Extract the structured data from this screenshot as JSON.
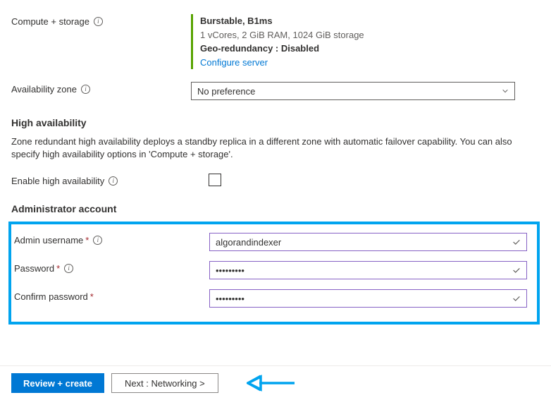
{
  "compute": {
    "label": "Compute + storage",
    "tier": "Burstable, B1ms",
    "specs": "1 vCores, 2 GiB RAM, 1024 GiB storage",
    "geo": "Geo-redundancy : Disabled",
    "configure": "Configure server"
  },
  "availability": {
    "label": "Availability zone",
    "value": "No preference"
  },
  "high_availability": {
    "header": "High availability",
    "desc": "Zone redundant high availability deploys a standby replica in a different zone with automatic failover capability. You can also specify high availability options in 'Compute + storage'.",
    "enable_label": "Enable high availability"
  },
  "admin": {
    "header": "Administrator account",
    "username_label": "Admin username",
    "username_value": "algorandindexer",
    "password_label": "Password",
    "password_value": "•••••••••",
    "confirm_label": "Confirm password",
    "confirm_value": "•••••••••"
  },
  "footer": {
    "review": "Review + create",
    "next": "Next : Networking >"
  },
  "colors": {
    "highlight": "#00a4ef",
    "primary": "#0078d4",
    "input_border": "#8661c5"
  }
}
